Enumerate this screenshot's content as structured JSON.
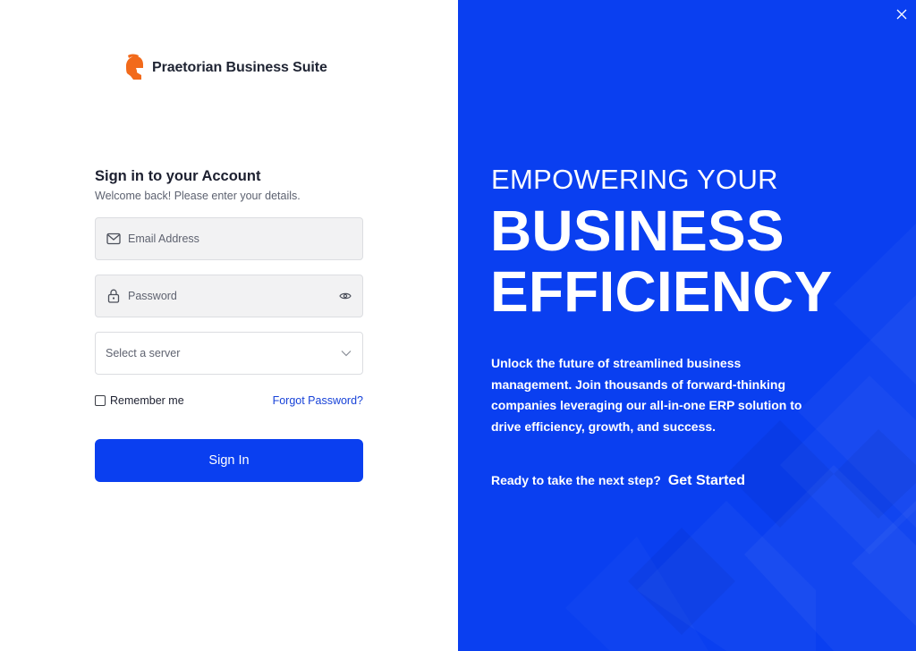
{
  "brand": {
    "name": "Praetorian Business Suite",
    "logo_icon": "spartan-helmet-icon",
    "logo_color": "#f26a1b"
  },
  "form": {
    "title": "Sign in to your Account",
    "subtitle": "Welcome back! Please enter your details.",
    "email": {
      "placeholder": "Email Address",
      "value": "",
      "icon": "mail-icon"
    },
    "password": {
      "placeholder": "Password",
      "value": "",
      "icon": "lock-icon",
      "toggle_icon": "eye-icon"
    },
    "server": {
      "placeholder": "Select a server",
      "icon": "chevron-down-icon"
    },
    "remember_label": "Remember me",
    "remember_checked": false,
    "forgot_label": "Forgot Password?",
    "submit_label": "Sign In"
  },
  "promo": {
    "eyebrow": "EMPOWERING YOUR",
    "headline_line1": "BUSINESS",
    "headline_line2": "EFFICIENCY",
    "pitch": "Unlock the future of streamlined business management. Join thousands of forward-thinking companies leveraging our all-in-one ERP solution to drive efficiency, growth, and success.",
    "cta_prompt": "Ready to take the next step?",
    "cta_link": "Get Started",
    "close_icon": "close-icon"
  },
  "colors": {
    "accent": "#0a3ff0",
    "link": "#1742d8",
    "brand_orange": "#f26a1b"
  }
}
